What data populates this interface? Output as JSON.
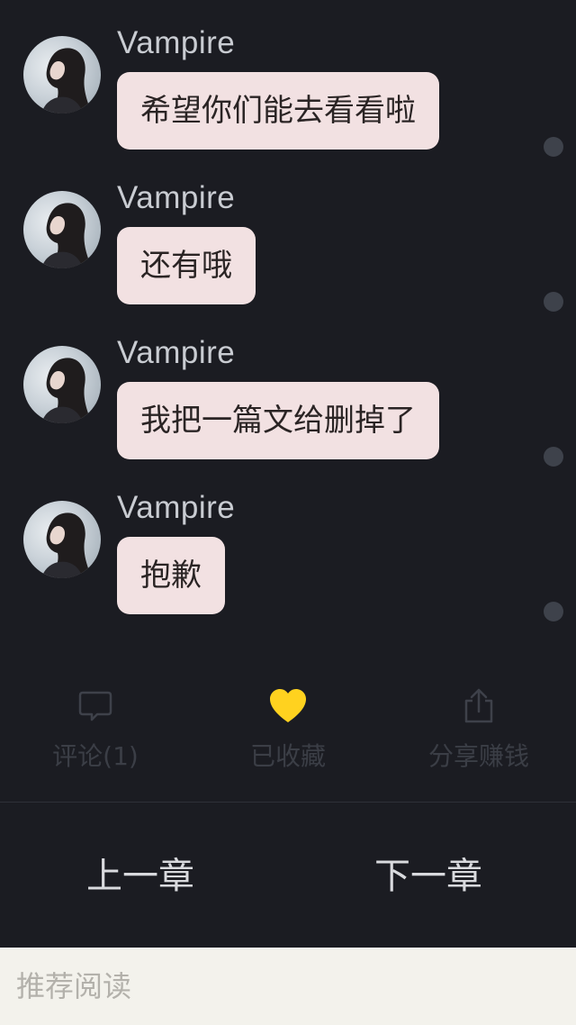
{
  "messages": [
    {
      "sender": "Vampire",
      "text": "希望你们能去看看啦"
    },
    {
      "sender": "Vampire",
      "text": "还有哦"
    },
    {
      "sender": "Vampire",
      "text": "我把一篇文给删掉了"
    },
    {
      "sender": "Vampire",
      "text": "抱歉"
    }
  ],
  "actions": {
    "comment": {
      "label": "评论(1)",
      "icon": "comment-icon"
    },
    "favorite": {
      "label": "已收藏",
      "icon": "heart-icon",
      "color": "#ffd21f"
    },
    "share": {
      "label": "分享赚钱",
      "icon": "share-icon"
    }
  },
  "nav": {
    "prev_label": "上一章",
    "next_label": "下一章"
  },
  "recommend": {
    "label": "推荐阅读"
  },
  "colors": {
    "background": "#1b1c22",
    "bubble": "#f2e1e2",
    "accent_heart": "#ffd21f"
  }
}
